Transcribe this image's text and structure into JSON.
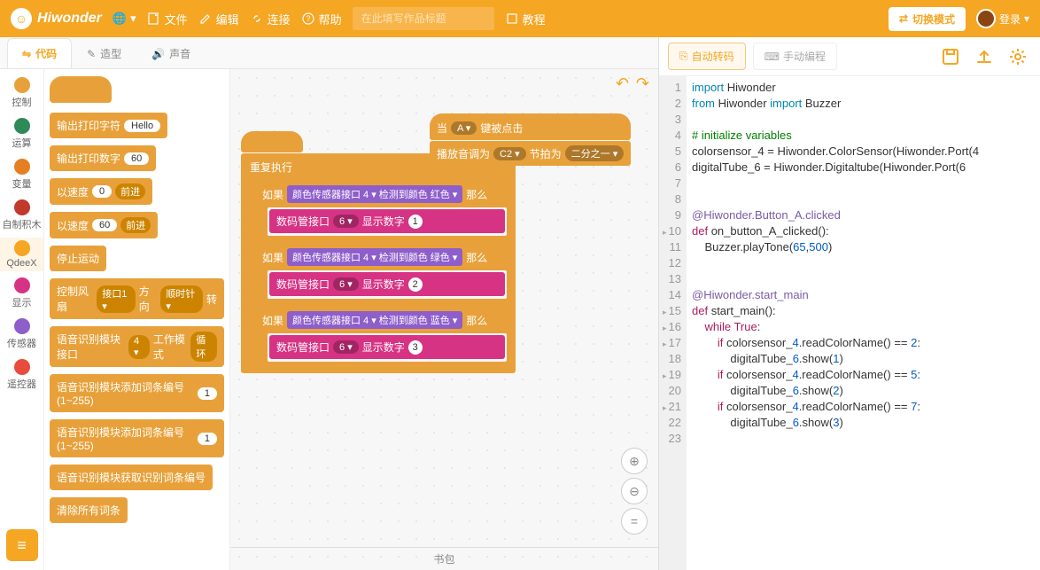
{
  "brand": "Hiwonder",
  "topbar": {
    "globe": "🌐",
    "file": "文件",
    "edit": "编辑",
    "connect": "连接",
    "help": "帮助",
    "title_placeholder": "在此填写作品标题",
    "tutorial": "教程",
    "switch_mode": "切换模式",
    "login": "登录"
  },
  "tabs": {
    "code": "代码",
    "costumes": "造型",
    "sounds": "声音"
  },
  "categories": [
    {
      "label": "控制",
      "color": "#E8A13A"
    },
    {
      "label": "运算",
      "color": "#2E8B57"
    },
    {
      "label": "变量",
      "color": "#E67E22"
    },
    {
      "label": "自制积木",
      "color": "#C0392B"
    },
    {
      "label": "QdeeX",
      "color": "#F5A623"
    },
    {
      "label": "显示",
      "color": "#D63384"
    },
    {
      "label": "传感器",
      "color": "#8E5ECB"
    },
    {
      "label": "遥控器",
      "color": "#E74C3C"
    }
  ],
  "palette": {
    "b_print_str": "输出打印字符",
    "b_print_str_arg": "Hello",
    "b_print_num": "输出打印数字",
    "b_print_num_arg": "60",
    "b_speed0": "以速度",
    "b_speed0_arg": "0",
    "b_forward": "前进",
    "b_speed60": "以速度",
    "b_speed60_arg": "60",
    "b_stop": "停止运动",
    "b_fan": "控制风扇",
    "b_fan_port": "接口1 ▾",
    "b_fan_dir": "方向",
    "b_fan_cw": "顺时针 ▾",
    "b_fan_spd": "转",
    "b_voice_mode": "语音识别模块接口",
    "b_voice_port": "4 ▾",
    "b_voice_work": "工作模式",
    "b_voice_loop": "循环",
    "b_voice_add": "语音识别模块添加词条编号(1~255)",
    "b_voice_add_arg": "1",
    "b_voice_get": "语音识别模块获取识别词条编号",
    "b_clear": "清除所有词条"
  },
  "canvas": {
    "main_hat_spacer": " ",
    "loop": "重复执行",
    "if": "如果",
    "then": "那么",
    "color_sensor": "颜色传感器接口",
    "port4": "4 ▾",
    "detect": "检测到颜色",
    "red": "红色 ▾",
    "green": "绿色 ▾",
    "blue": "蓝色 ▾",
    "tube": "数码管接口",
    "port6": "6 ▾",
    "show_num": "显示数字",
    "n1": "1",
    "n2": "2",
    "n3": "3",
    "when": "当",
    "key_a": "A ▾",
    "key_pressed": "键被点击",
    "play_tone": "播放音调为",
    "c2": "C2 ▾",
    "beat": "节拍为",
    "half": "二分之一 ▾"
  },
  "rightTabs": {
    "auto": "自动转码",
    "manual": "手动编程"
  },
  "code_lines": [
    {
      "n": 1,
      "t": "import",
      "text": "import Hiwonder"
    },
    {
      "n": 2,
      "t": "import2",
      "text": "from Hiwonder import Buzzer"
    },
    {
      "n": 3,
      "t": "blank",
      "text": ""
    },
    {
      "n": 4,
      "t": "comment",
      "text": "# initialize variables"
    },
    {
      "n": 5,
      "t": "assign",
      "text": "colorsensor_4 = Hiwonder.ColorSensor(Hiwonder.Port(4"
    },
    {
      "n": 6,
      "t": "assign",
      "text": "digitalTube_6 = Hiwonder.Digitaltube(Hiwonder.Port(6"
    },
    {
      "n": 7,
      "t": "blank",
      "text": ""
    },
    {
      "n": 8,
      "t": "blank",
      "text": ""
    },
    {
      "n": 9,
      "t": "deco",
      "text": "@Hiwonder.Button_A.clicked"
    },
    {
      "n": 10,
      "t": "def",
      "fold": true,
      "text": "def on_button_A_clicked():"
    },
    {
      "n": 11,
      "t": "body",
      "text": "    Buzzer.playTone(65,500)"
    },
    {
      "n": 12,
      "t": "blank",
      "text": ""
    },
    {
      "n": 13,
      "t": "blank",
      "text": ""
    },
    {
      "n": 14,
      "t": "deco",
      "text": "@Hiwonder.start_main"
    },
    {
      "n": 15,
      "t": "def",
      "fold": true,
      "text": "def start_main():"
    },
    {
      "n": 16,
      "t": "ctrl",
      "fold": true,
      "text": "    while True:"
    },
    {
      "n": 17,
      "t": "ctrl",
      "fold": true,
      "text": "        if colorsensor_4.readColorName() == 2:"
    },
    {
      "n": 18,
      "t": "body",
      "text": "            digitalTube_6.show(1)"
    },
    {
      "n": 19,
      "t": "ctrl",
      "fold": true,
      "text": "        if colorsensor_4.readColorName() == 5:"
    },
    {
      "n": 20,
      "t": "body",
      "text": "            digitalTube_6.show(2)"
    },
    {
      "n": 21,
      "t": "ctrl",
      "fold": true,
      "text": "        if colorsensor_4.readColorName() == 7:"
    },
    {
      "n": 22,
      "t": "body",
      "text": "            digitalTube_6.show(3)"
    },
    {
      "n": 23,
      "t": "blank",
      "text": ""
    }
  ],
  "backpack": "书包"
}
